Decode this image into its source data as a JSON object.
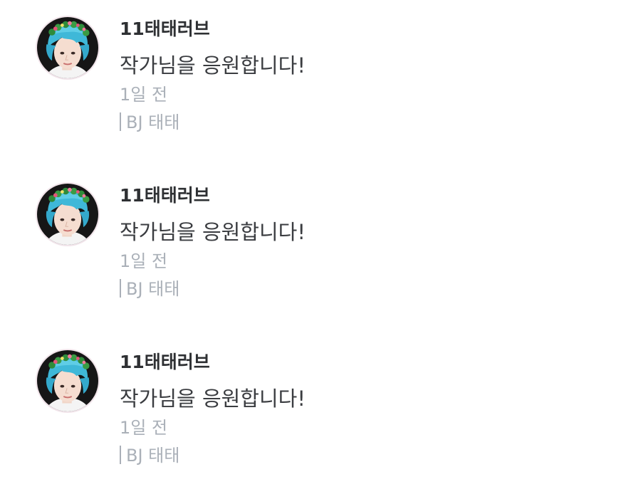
{
  "comments": [
    {
      "username": "11태태러브",
      "message": "작가님을 응원합니다!",
      "time": "1일 전",
      "tag": "BJ 태태",
      "avatar_icon": "user-avatar-photo"
    },
    {
      "username": "11태태러브",
      "message": "작가님을 응원합니다!",
      "time": "1일 전",
      "tag": "BJ 태태",
      "avatar_icon": "user-avatar-photo"
    },
    {
      "username": "11태태러브",
      "message": "작가님을 응원합니다!",
      "time": "1일 전",
      "tag": "BJ 태태",
      "avatar_icon": "user-avatar-photo"
    }
  ],
  "colors": {
    "username": "#2e3033",
    "message": "#3a3c40",
    "meta": "#aab0b8",
    "avatar_hair": "#3fb8d8",
    "avatar_background": "#1a1a1a"
  }
}
